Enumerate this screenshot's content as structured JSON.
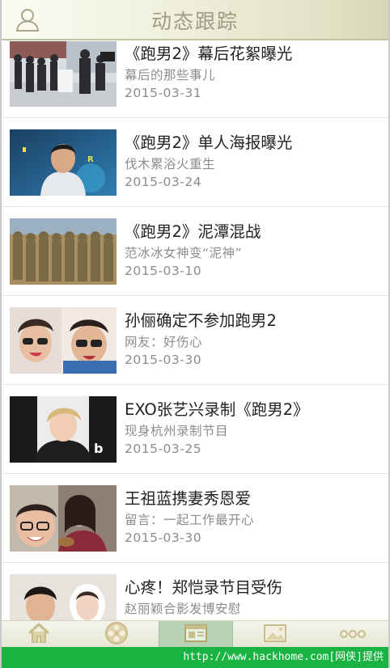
{
  "header": {
    "title": "动态跟踪",
    "avatar_icon": "user-profile-icon"
  },
  "news": [
    {
      "title": "《跑男2》幕后花絮曝光",
      "subtitle": "幕后的那些事儿",
      "date": "2015-03-31"
    },
    {
      "title": "《跑男2》单人海报曝光",
      "subtitle": "伐木累浴火重生",
      "date": "2015-03-24"
    },
    {
      "title": "《跑男2》泥潭混战",
      "subtitle": "范冰冰女神变“泥神”",
      "date": "2015-03-10"
    },
    {
      "title": "孙俪确定不参加跑男2",
      "subtitle": "网友：好伤心",
      "date": "2015-03-30"
    },
    {
      "title": "EXO张艺兴录制《跑男2》",
      "subtitle": "现身杭州录制节目",
      "date": "2015-03-25"
    },
    {
      "title": "王祖蓝携妻秀恩爱",
      "subtitle": "留言：一起工作最开心",
      "date": "2015-03-30"
    },
    {
      "title": "心疼！郑恺录节目受伤",
      "subtitle": "赵丽颖合影发博安慰",
      "date": ""
    }
  ],
  "tabs": [
    {
      "icon": "home-icon",
      "active": false
    },
    {
      "icon": "film-reel-icon",
      "active": false
    },
    {
      "icon": "news-icon",
      "active": true
    },
    {
      "icon": "picture-icon",
      "active": false
    },
    {
      "icon": "more-icon",
      "active": false
    }
  ],
  "watermark": {
    "text": "http://www.hackhome.com[网侠]提供"
  },
  "colors": {
    "header_title": "#9e9b83",
    "tab_active": "#b8d3b4",
    "icon": "#c9bc8b",
    "watermark_bg": "#19b341"
  }
}
